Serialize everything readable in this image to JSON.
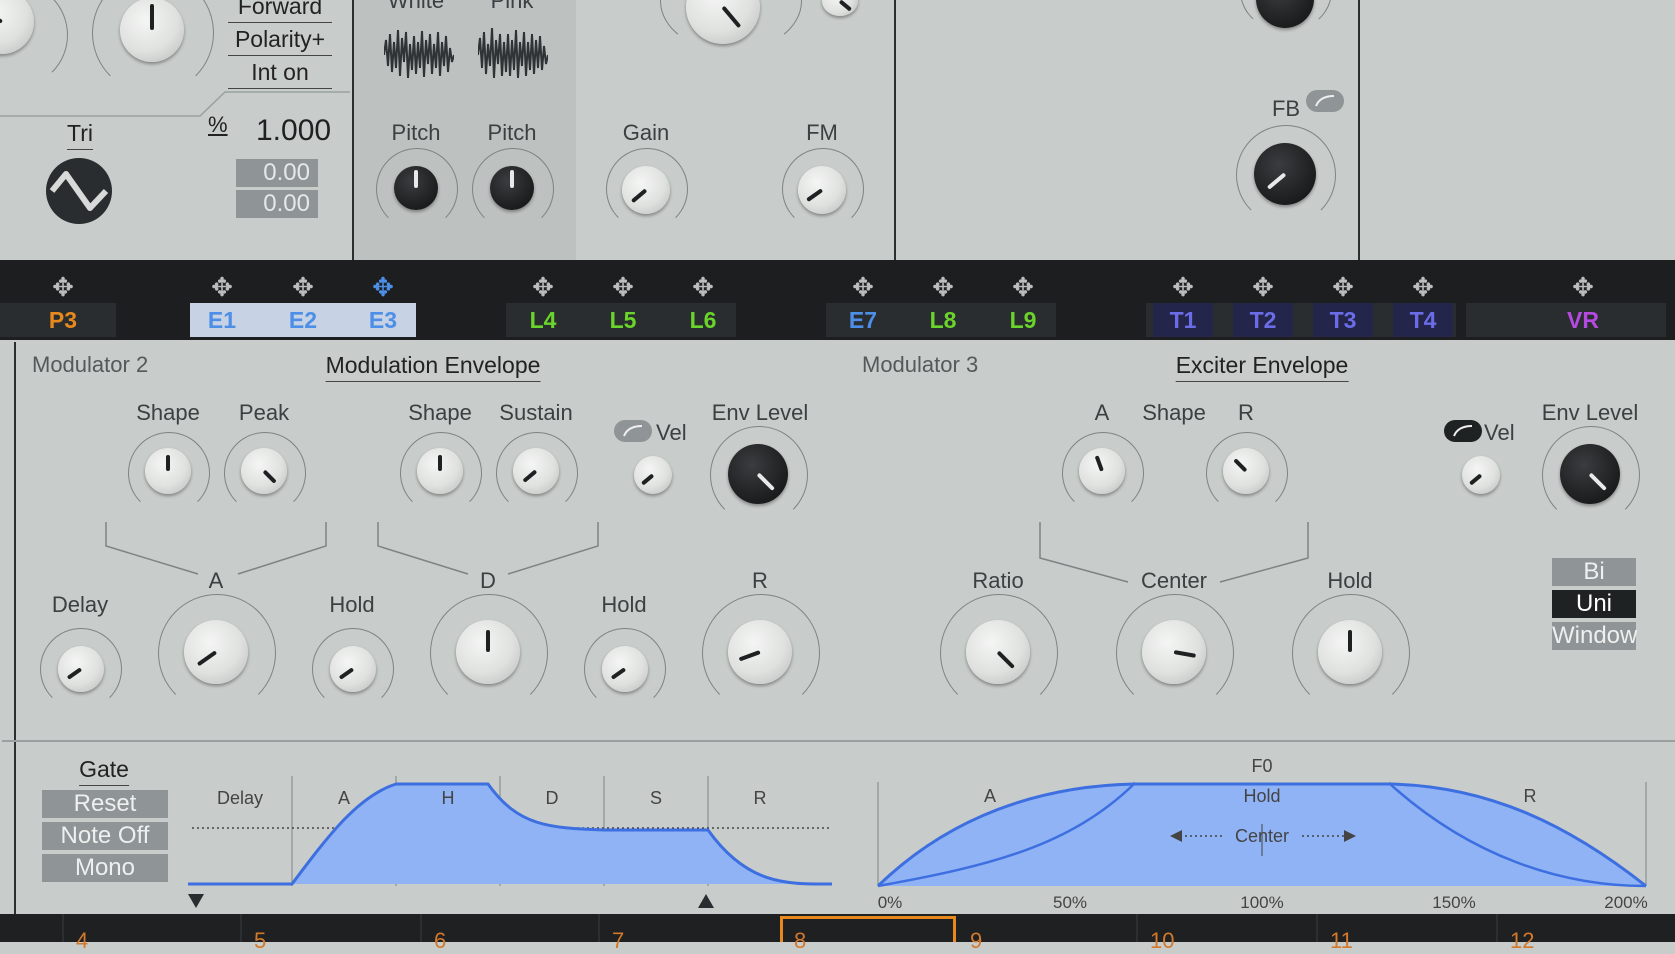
{
  "top": {
    "lfo": {
      "polarity_lines": [
        "Forward",
        "Polarity+",
        "Int on"
      ],
      "wave_label": "Tri",
      "percent_symbol": "%",
      "rate_value": "1.000",
      "offset1": "0.00",
      "offset2": "0.00"
    },
    "noise": {
      "white_label": "White",
      "pink_label": "Pink",
      "pitch1": "Pitch",
      "pitch2": "Pitch"
    },
    "filter": {
      "gain_label": "Gain",
      "fm_label": "FM"
    },
    "fx": {
      "fb_label": "FB"
    }
  },
  "modbar": {
    "tags": [
      {
        "label": "P3",
        "color": "#e8891e"
      },
      {
        "label": "E1",
        "color": "#4d8fe6"
      },
      {
        "label": "E2",
        "color": "#4d8fe6"
      },
      {
        "label": "E3",
        "color": "#4d8fe6"
      },
      {
        "label": "L4",
        "color": "#6ad42a"
      },
      {
        "label": "L5",
        "color": "#6ad42a"
      },
      {
        "label": "L6",
        "color": "#6ad42a"
      },
      {
        "label": "E7",
        "color": "#4d8fe6"
      },
      {
        "label": "L8",
        "color": "#6ad42a"
      },
      {
        "label": "L9",
        "color": "#6ad42a"
      },
      {
        "label": "T1",
        "color": "#6b6de8"
      },
      {
        "label": "T2",
        "color": "#6b6de8"
      },
      {
        "label": "T3",
        "color": "#6b6de8"
      },
      {
        "label": "T4",
        "color": "#6b6de8"
      },
      {
        "label": "VR",
        "color": "#b54ae0"
      }
    ]
  },
  "mod2": {
    "section": "Modulator 2",
    "title": "Modulation Envelope",
    "shape1": "Shape",
    "peak": "Peak",
    "shape2": "Shape",
    "sustain": "Sustain",
    "vel": "Vel",
    "env_level": "Env Level",
    "delay": "Delay",
    "a": "A",
    "hold1": "Hold",
    "d": "D",
    "hold2": "Hold",
    "r": "R",
    "gate_title": "Gate",
    "gate_buttons": [
      "Reset",
      "Note Off",
      "Mono"
    ],
    "graph_labels": [
      "Delay",
      "A",
      "H",
      "D",
      "S",
      "R"
    ]
  },
  "mod3": {
    "section": "Modulator 3",
    "title": "Exciter Envelope",
    "a": "A",
    "shape": "Shape",
    "r": "R",
    "vel": "Vel",
    "env_level": "Env Level",
    "ratio": "Ratio",
    "center": "Center",
    "hold": "Hold",
    "mode_buttons": [
      "Bi",
      "Uni",
      "Window"
    ],
    "mode_selected": "Uni",
    "graph_top": "F0",
    "graph_labels": [
      "A",
      "Hold",
      "R"
    ],
    "graph_center": "Center",
    "x_ticks": [
      "0%",
      "50%",
      "100%",
      "150%",
      "200%"
    ]
  },
  "bottom": {
    "slots": [
      "4",
      "5",
      "6",
      "7",
      "8",
      "9",
      "10",
      "11",
      "12"
    ],
    "selected": "8"
  },
  "colors": {
    "accent_blue": "#5b93f0",
    "fill_blue": "#8fb3f5",
    "orange": "#e8891e"
  }
}
